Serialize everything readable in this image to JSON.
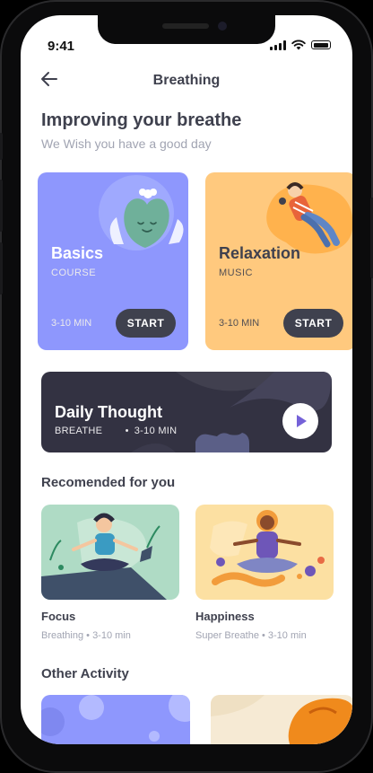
{
  "status_bar": {
    "time": "9:41"
  },
  "header": {
    "title": "Breathing",
    "back_icon": "arrow-left-icon"
  },
  "intro": {
    "heading": "Improving your breathe",
    "subheading": "We Wish you have a good day"
  },
  "featured_cards": [
    {
      "title": "Basics",
      "subtitle": "COURSE",
      "duration": "3-10 MIN",
      "button": "START",
      "background": "#8E97FD",
      "subtitle_color": "#EBEAEC"
    },
    {
      "title": "Relaxation",
      "subtitle": "MUSIC",
      "duration": "3-10 MIN",
      "button": "START",
      "background": "#FFC97E",
      "subtitle_color": "#524F53"
    }
  ],
  "daily_thought": {
    "title": "Daily Thought",
    "category": "BREATHE",
    "duration": "3-10 MIN",
    "play_icon": "play-icon"
  },
  "recommended": {
    "heading": "Recomended for you",
    "items": [
      {
        "title": "Focus",
        "category": "Breathing",
        "duration": "3-10 min",
        "background": "#AFDBC5"
      },
      {
        "title": "Happiness",
        "category": "Super Breathe",
        "duration": "3-10 min",
        "background": "#FCE0A2"
      }
    ]
  },
  "other_activity": {
    "heading": "Other Activity"
  },
  "colors": {
    "text_dark": "#3F414E",
    "text_muted": "#A1A4B2",
    "accent": "#8E97FD"
  }
}
